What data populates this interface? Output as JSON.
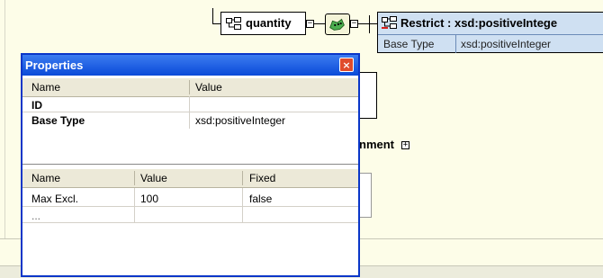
{
  "diagram": {
    "element_name": "quantity",
    "restrict_title": "Restrict :  xsd:positiveIntege",
    "restrict_row": {
      "label": "Base Type",
      "value": "xsd:positiveInteger"
    },
    "partial_element": "nment"
  },
  "properties_window": {
    "title": "Properties",
    "close_glyph": "×",
    "top_table": {
      "headers": [
        "Name",
        "Value"
      ],
      "rows": [
        {
          "name": "ID",
          "value": ""
        },
        {
          "name": "Base Type",
          "value": "xsd:positiveInteger"
        }
      ]
    },
    "facets_table": {
      "headers": [
        "Name",
        "Value",
        "Fixed"
      ],
      "rows": [
        {
          "name": "Max Excl.",
          "value": "100",
          "fixed": "false"
        },
        {
          "name": "...",
          "value": "",
          "fixed": ""
        }
      ]
    }
  },
  "colors": {
    "canvas": "#fdfde8",
    "restrict_box": "#cfe0f2",
    "title_bar": "#0a4ad8",
    "close_button": "#e04c2c"
  }
}
